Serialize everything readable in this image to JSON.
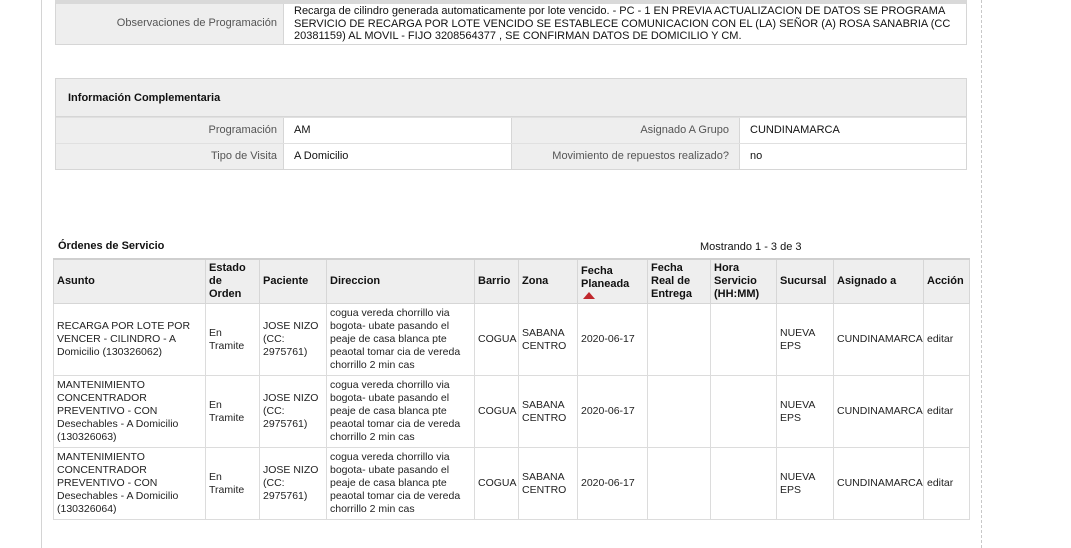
{
  "observaciones": {
    "label": "Observaciones de Programación",
    "value": "Recarga de cilindro generada automaticamente por lote vencido. - PC - 1 EN PREVIA ACTUALIZACION DE DATOS SE PROGRAMA SERVICIO DE RECARGA POR LOTE VENCIDO SE ESTABLECE COMUNICACION CON EL (LA) SEÑOR (A) ROSA SANABRIA (CC 20381159) AL MOVIL - FIJO 3208564377 , SE CONFIRMAN DATOS DE DOMICILIO Y CM."
  },
  "info": {
    "title": "Información Complementaria",
    "rows": [
      {
        "label1": "Programación",
        "value1": "AM",
        "label2": "Asignado A Grupo",
        "value2": "CUNDINAMARCA"
      },
      {
        "label1": "Tipo de Visita",
        "value1": "A Domicilio",
        "label2": "Movimiento de repuestos realizado?",
        "value2": "no"
      }
    ]
  },
  "orders": {
    "title": "Órdenes de Servicio",
    "count_text": "Mostrando 1 - 3 de 3",
    "sort_color": "#c0282d",
    "columns": [
      "Asunto",
      "Estado de Orden",
      "Paciente",
      "Direccion",
      "Barrio",
      "Zona",
      "Fecha Planeada",
      "Fecha Real de Entrega",
      "Hora Servicio (HH:MM)",
      "Sucursal",
      "Asignado a",
      "Acción"
    ],
    "rows": [
      {
        "asunto": "RECARGA POR LOTE POR VENCER - CILINDRO - A Domicilio (130326062)",
        "estado": "En Tramite",
        "paciente": "JOSE NIZO (CC: 2975761)",
        "direccion": "cogua vereda chorrillo via bogota- ubate pasando el peaje de casa blanca pte peaotal tomar cia de vereda chorrillo 2 min cas",
        "barrio": "COGUA",
        "zona": "SABANA CENTRO",
        "fecha_planeada": "2020-06-17",
        "fecha_real": "",
        "hora": "",
        "sucursal": "NUEVA EPS",
        "asignado": "CUNDINAMARCA",
        "accion": "editar"
      },
      {
        "asunto": "MANTENIMIENTO CONCENTRADOR PREVENTIVO - CON Desechables - A Domicilio (130326063)",
        "estado": "En Tramite",
        "paciente": "JOSE NIZO (CC: 2975761)",
        "direccion": "cogua vereda chorrillo via bogota- ubate pasando el peaje de casa blanca pte peaotal tomar cia de vereda chorrillo 2 min cas",
        "barrio": "COGUA",
        "zona": "SABANA CENTRO",
        "fecha_planeada": "2020-06-17",
        "fecha_real": "",
        "hora": "",
        "sucursal": "NUEVA EPS",
        "asignado": "CUNDINAMARCA",
        "accion": "editar"
      },
      {
        "asunto": "MANTENIMIENTO CONCENTRADOR PREVENTIVO - CON Desechables - A Domicilio (130326064)",
        "estado": "En Tramite",
        "paciente": "JOSE NIZO (CC: 2975761)",
        "direccion": "cogua vereda chorrillo via bogota- ubate pasando el peaje de casa blanca pte peaotal tomar cia de vereda chorrillo 2 min cas",
        "barrio": "COGUA",
        "zona": "SABANA CENTRO",
        "fecha_planeada": "2020-06-17",
        "fecha_real": "",
        "hora": "",
        "sucursal": "NUEVA EPS",
        "asignado": "CUNDINAMARCA",
        "accion": "editar"
      }
    ]
  }
}
